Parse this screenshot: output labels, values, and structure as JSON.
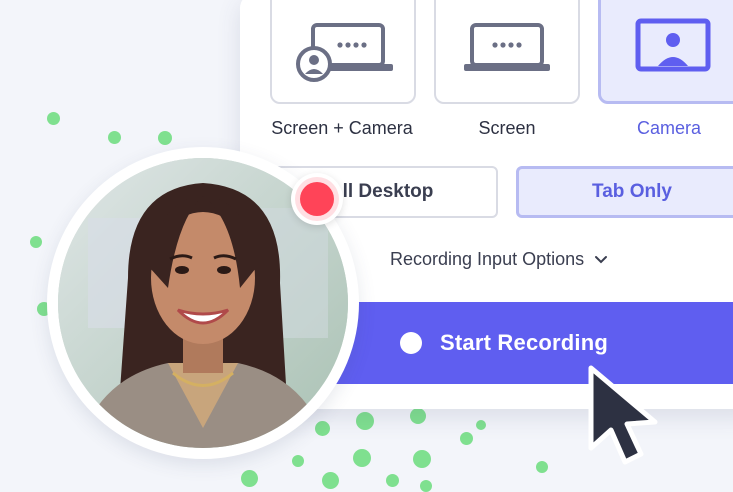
{
  "modes": [
    {
      "label": "Screen + Camera",
      "icon": "laptop-with-camera-icon",
      "selected": false
    },
    {
      "label": "Screen",
      "icon": "laptop-icon",
      "selected": false
    },
    {
      "label": "Camera",
      "icon": "webcam-person-icon",
      "selected": true
    }
  ],
  "capture_scope": {
    "full_desktop_label": "ll Desktop",
    "tab_only_label": "Tab Only",
    "selected": "Tab Only"
  },
  "recording_input_options": {
    "label": "Recording Input Options",
    "icon": "chevron-down-icon"
  },
  "start_button": {
    "label": "Start Recording",
    "icon": "record-dot-icon"
  },
  "recording_indicator": {
    "icon": "recording-red-dot-icon"
  },
  "avatar": {
    "description_icon": "camera-preview-avatar"
  },
  "colors": {
    "accent": "#5f5ef0",
    "accent_light": "#e9ebfd",
    "record_red": "#ff4458",
    "dot_green": "#7fe08f"
  }
}
